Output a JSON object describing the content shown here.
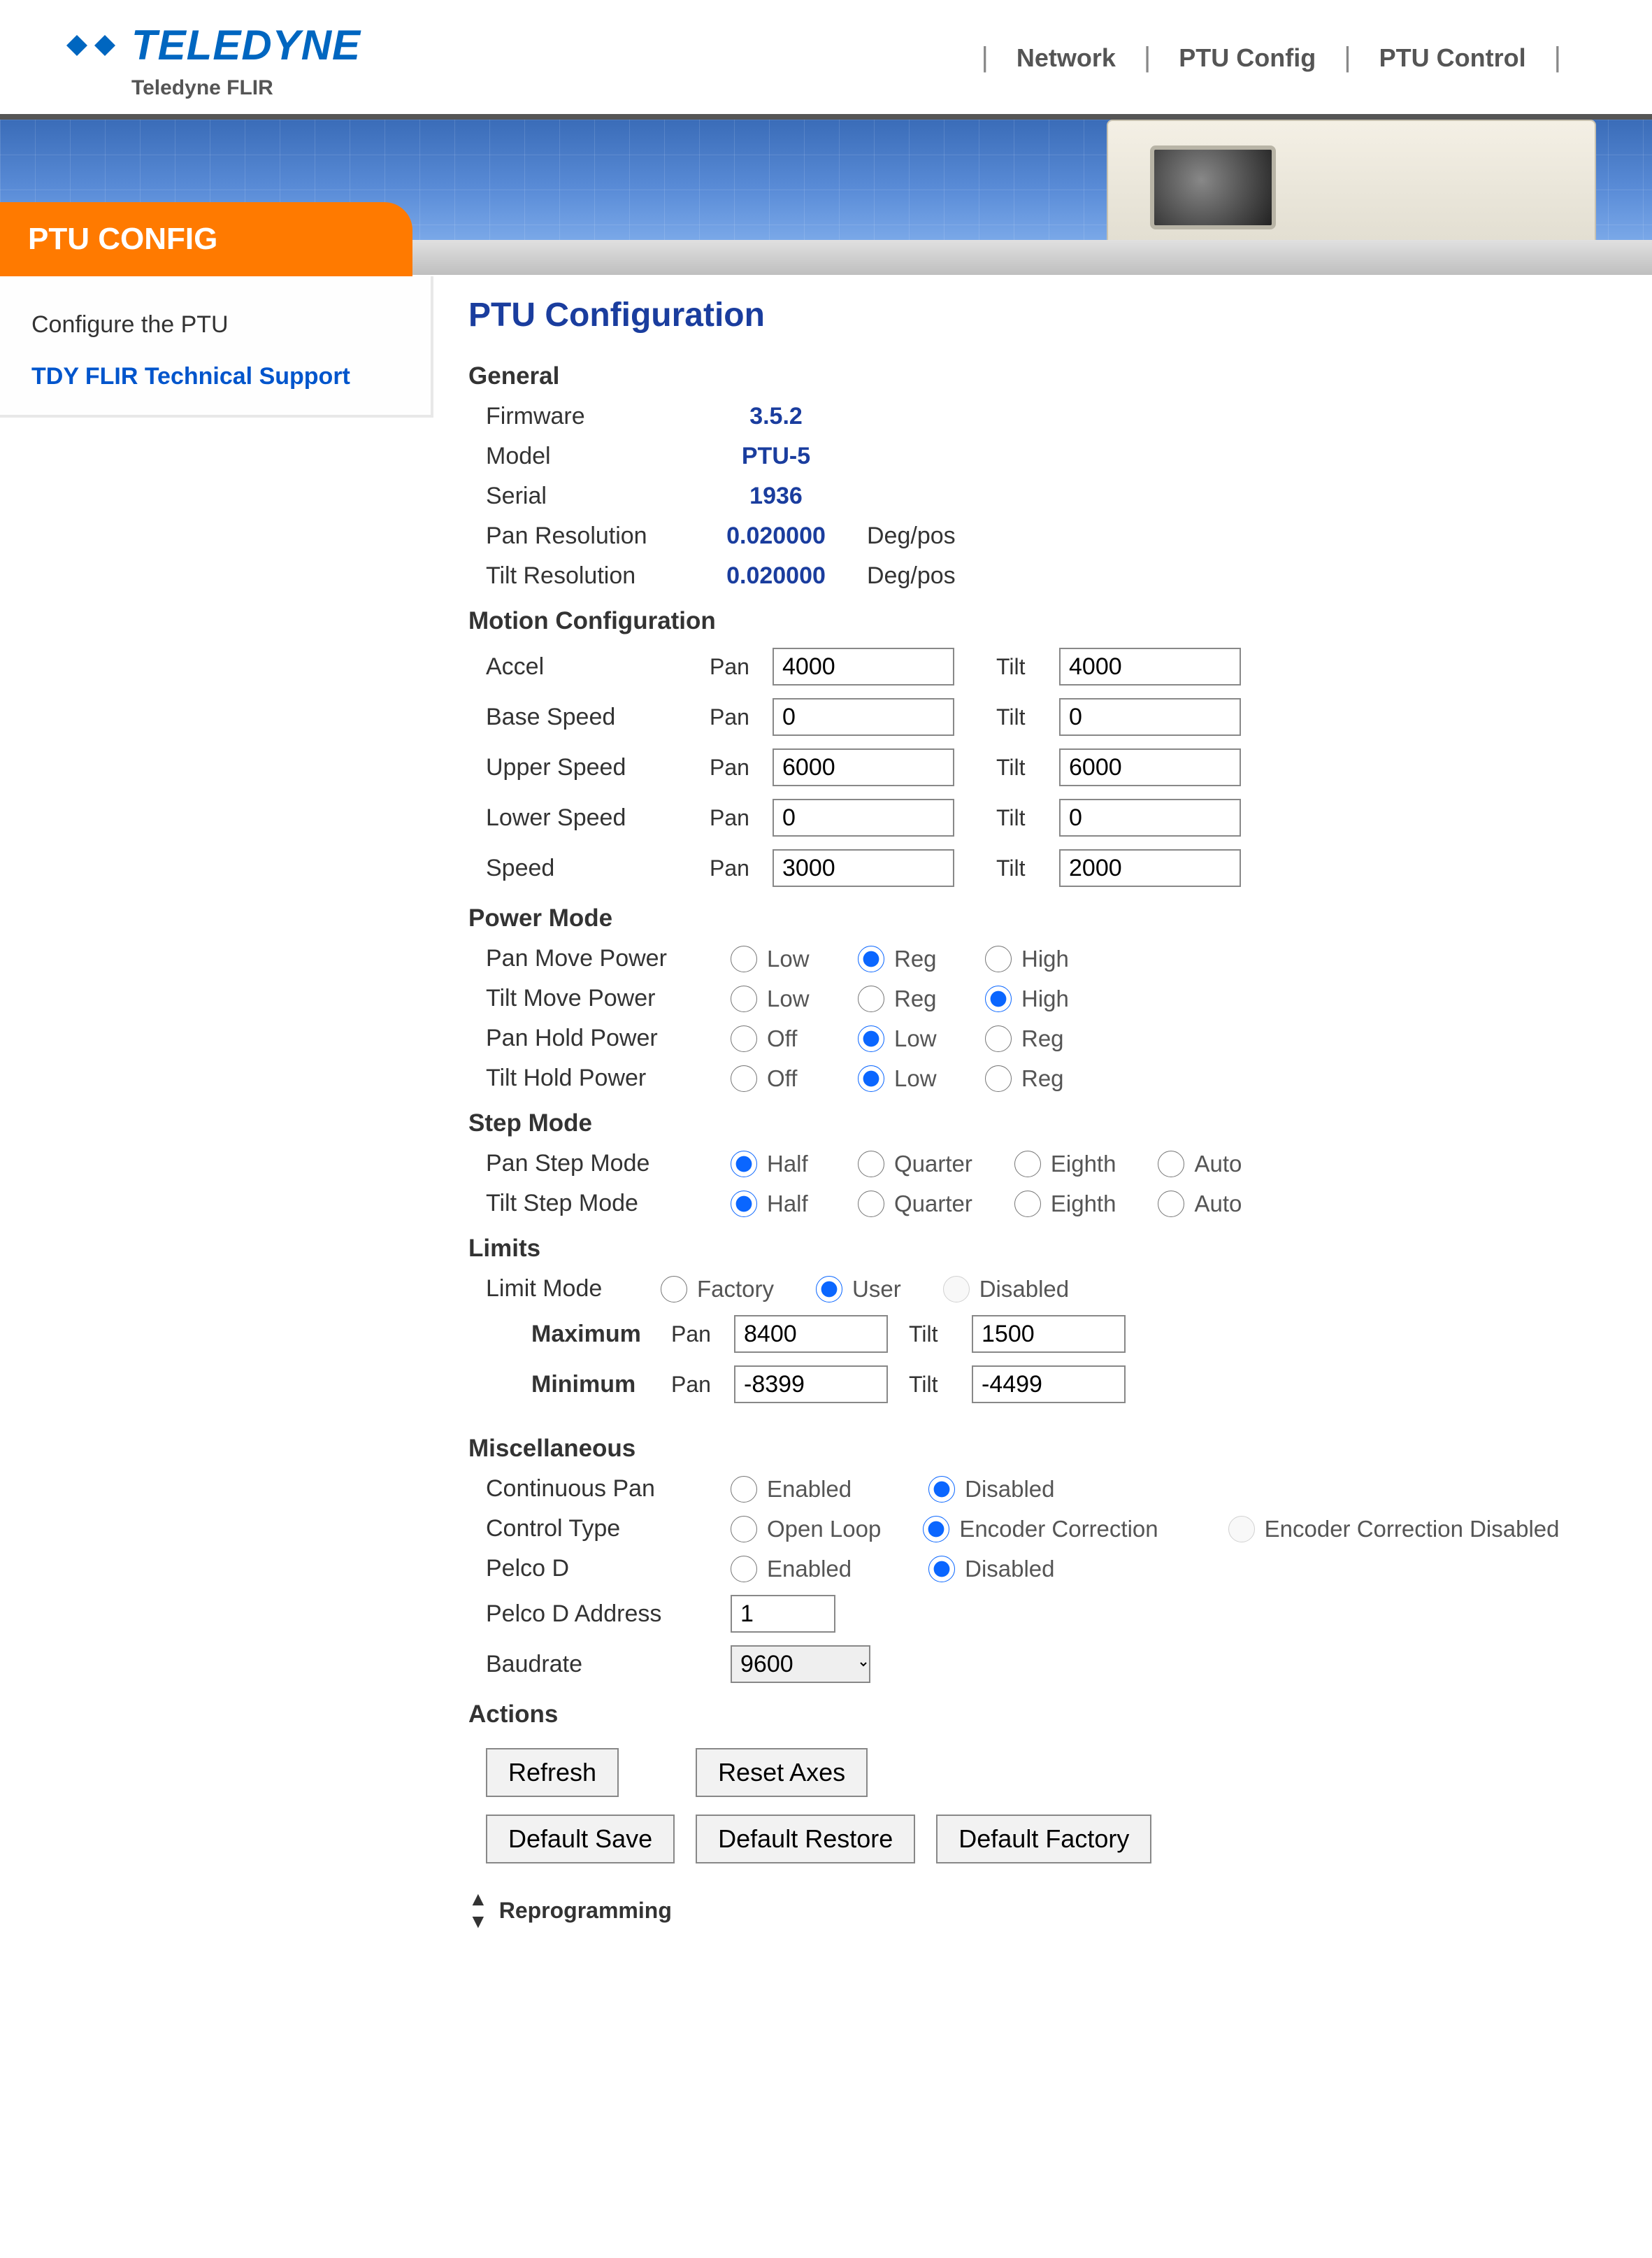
{
  "brand": {
    "name": "TELEDYNE",
    "sub": "Teledyne FLIR"
  },
  "nav": {
    "network": "Network",
    "ptu_config": "PTU Config",
    "ptu_control": "PTU Control"
  },
  "sidebar": {
    "tab": "PTU CONFIG",
    "item_config": "Configure the PTU",
    "item_support": "TDY FLIR Technical Support"
  },
  "page_title": "PTU Configuration",
  "sections": {
    "general": "General",
    "motion": "Motion Configuration",
    "power": "Power Mode",
    "step": "Step Mode",
    "limits": "Limits",
    "misc": "Miscellaneous",
    "actions": "Actions",
    "reprog": "Reprogramming"
  },
  "general": {
    "firmware_label": "Firmware",
    "firmware_value": "3.5.2",
    "model_label": "Model",
    "model_value": "PTU-5",
    "serial_label": "Serial",
    "serial_value": "1936",
    "panres_label": "Pan Resolution",
    "panres_value": "0.020000",
    "panres_unit": "Deg/pos",
    "tiltres_label": "Tilt Resolution",
    "tiltres_value": "0.020000",
    "tiltres_unit": "Deg/pos"
  },
  "axis": {
    "pan": "Pan",
    "tilt": "Tilt"
  },
  "motion": {
    "accel_label": "Accel",
    "accel_pan": "4000",
    "accel_tilt": "4000",
    "base_label": "Base Speed",
    "base_pan": "0",
    "base_tilt": "0",
    "upper_label": "Upper Speed",
    "upper_pan": "6000",
    "upper_tilt": "6000",
    "lower_label": "Lower Speed",
    "lower_pan": "0",
    "lower_tilt": "0",
    "speed_label": "Speed",
    "speed_pan": "3000",
    "speed_tilt": "2000"
  },
  "power": {
    "pan_move_label": "Pan Move Power",
    "tilt_move_label": "Tilt Move Power",
    "pan_hold_label": "Pan Hold Power",
    "tilt_hold_label": "Tilt Hold Power",
    "opt_low": "Low",
    "opt_reg": "Reg",
    "opt_high": "High",
    "opt_off": "Off"
  },
  "step": {
    "pan_label": "Pan Step Mode",
    "tilt_label": "Tilt Step Mode",
    "half": "Half",
    "quarter": "Quarter",
    "eighth": "Eighth",
    "auto": "Auto"
  },
  "limits": {
    "mode_label": "Limit Mode",
    "factory": "Factory",
    "user": "User",
    "disabled": "Disabled",
    "max_label": "Maximum",
    "min_label": "Minimum",
    "max_pan": "8400",
    "max_tilt": "1500",
    "min_pan": "-8399",
    "min_tilt": "-4499"
  },
  "misc": {
    "cont_pan_label": "Continuous Pan",
    "control_label": "Control Type",
    "pelco_label": "Pelco D",
    "pelco_addr_label": "Pelco D Address",
    "baud_label": "Baudrate",
    "enabled": "Enabled",
    "disabled": "Disabled",
    "open_loop": "Open Loop",
    "enc_corr": "Encoder Correction",
    "enc_corr_dis": "Encoder Correction Disabled",
    "pelco_addr": "1",
    "baud": "9600"
  },
  "actions": {
    "refresh": "Refresh",
    "reset_axes": "Reset Axes",
    "default_save": "Default Save",
    "default_restore": "Default Restore",
    "default_factory": "Default Factory"
  }
}
